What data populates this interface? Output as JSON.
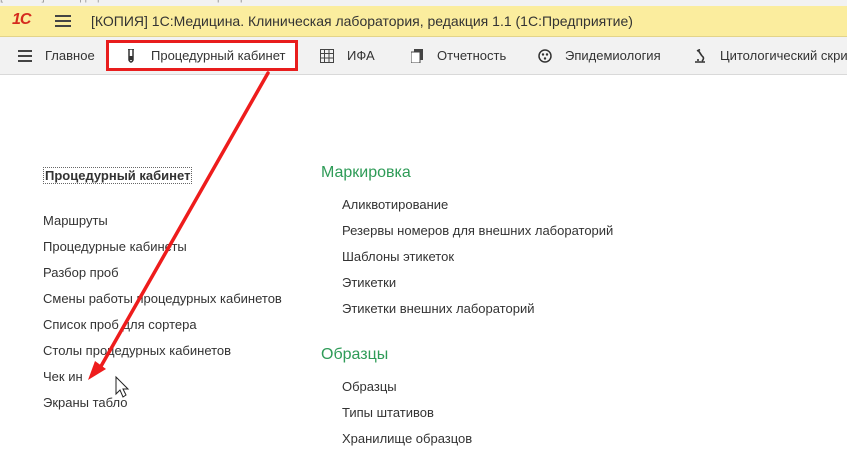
{
  "window": {
    "logo": "1С",
    "title": "[КОПИЯ] 1С:Медицина. Клиническая лаборатория, редакция 1.1  (1С:Предприятие)"
  },
  "sections": [
    {
      "label": "Главное",
      "icon": "menu-lines-icon"
    },
    {
      "label": "Процедурный кабинет",
      "icon": "test-tube-icon"
    },
    {
      "label": "ИФА",
      "icon": "grid-plate-icon"
    },
    {
      "label": "Отчетность",
      "icon": "report-icon"
    },
    {
      "label": "Эпидемиология",
      "icon": "virus-icon"
    },
    {
      "label": "Цитологический скри",
      "icon": "microscope-icon"
    }
  ],
  "left": {
    "heading": "Процедурный кабинет",
    "items": [
      "Маршруты",
      "Процедурные кабинеты",
      "Разбор проб",
      "Смены работы процедурных кабинетов",
      "Список проб для сортера",
      "Столы процедурных кабинетов",
      "Чек ин",
      "Экраны табло"
    ]
  },
  "groups": [
    {
      "title": "Маркировка",
      "items": [
        "Аликвотирование",
        "Резервы номеров для внешних лабораторий",
        "Шаблоны этикеток",
        "Этикетки",
        "Этикетки внешних лабораторий"
      ]
    },
    {
      "title": "Образцы",
      "items": [
        "Образцы",
        "Типы штативов",
        "Хранилище образцов"
      ]
    }
  ],
  "colors": {
    "accent": "#2e9b57",
    "highlight": "#e81d1d",
    "titlebar": "#fbed9e"
  }
}
